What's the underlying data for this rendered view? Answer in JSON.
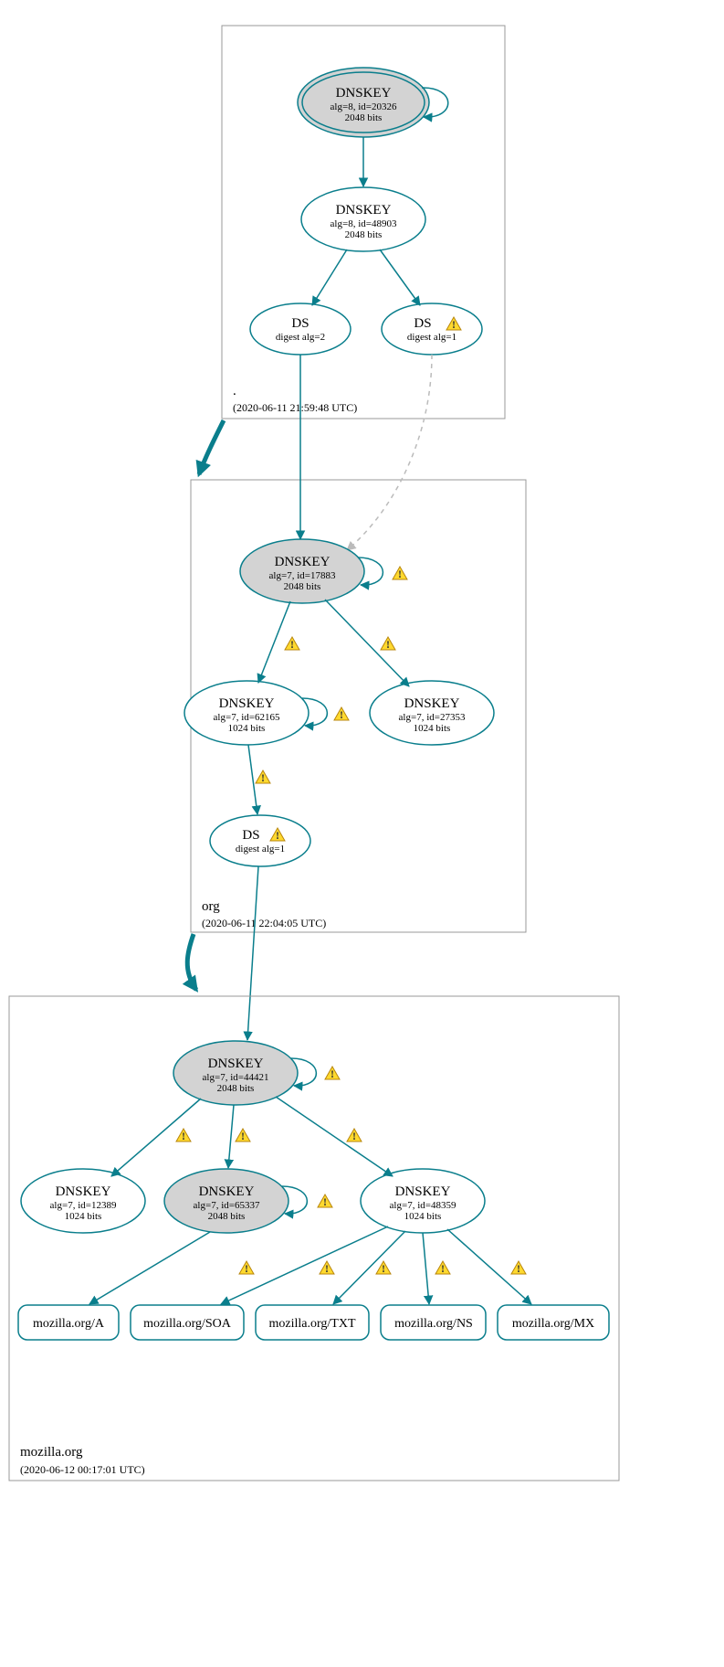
{
  "zones": {
    "root": {
      "label": ".",
      "timestamp": "(2020-06-11 21:59:48 UTC)"
    },
    "org": {
      "label": "org",
      "timestamp": "(2020-06-11 22:04:05 UTC)"
    },
    "mozilla": {
      "label": "mozilla.org",
      "timestamp": "(2020-06-12 00:17:01 UTC)"
    }
  },
  "nodes": {
    "root_ksk": {
      "title": "DNSKEY",
      "line1": "alg=8, id=20326",
      "line2": "2048 bits"
    },
    "root_zsk": {
      "title": "DNSKEY",
      "line1": "alg=8, id=48903",
      "line2": "2048 bits"
    },
    "root_ds1": {
      "title": "DS",
      "line1": "digest alg=2"
    },
    "root_ds2": {
      "title": "DS",
      "line1": "digest alg=1"
    },
    "org_ksk": {
      "title": "DNSKEY",
      "line1": "alg=7, id=17883",
      "line2": "2048 bits"
    },
    "org_zsk1": {
      "title": "DNSKEY",
      "line1": "alg=7, id=62165",
      "line2": "1024 bits"
    },
    "org_zsk2": {
      "title": "DNSKEY",
      "line1": "alg=7, id=27353",
      "line2": "1024 bits"
    },
    "org_ds": {
      "title": "DS",
      "line1": "digest alg=1"
    },
    "moz_ksk": {
      "title": "DNSKEY",
      "line1": "alg=7, id=44421",
      "line2": "2048 bits"
    },
    "moz_k1": {
      "title": "DNSKEY",
      "line1": "alg=7, id=12389",
      "line2": "1024 bits"
    },
    "moz_k2": {
      "title": "DNSKEY",
      "line1": "alg=7, id=65337",
      "line2": "2048 bits"
    },
    "moz_k3": {
      "title": "DNSKEY",
      "line1": "alg=7, id=48359",
      "line2": "1024 bits"
    }
  },
  "rr": {
    "a": "mozilla.org/A",
    "soa": "mozilla.org/SOA",
    "txt": "mozilla.org/TXT",
    "ns": "mozilla.org/NS",
    "mx": "mozilla.org/MX"
  }
}
